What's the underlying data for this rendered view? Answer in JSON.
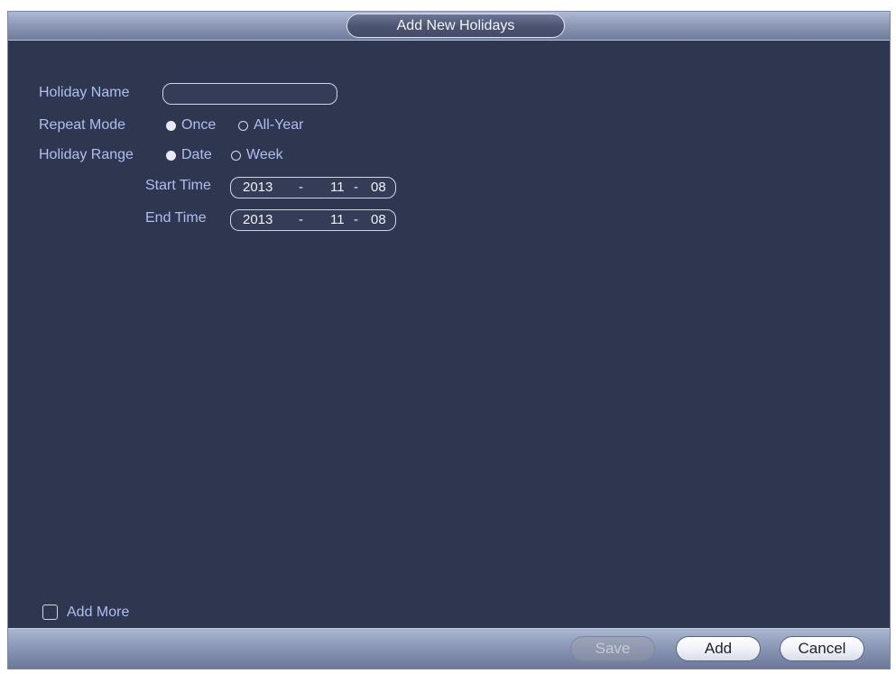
{
  "dialog": {
    "title": "Add New Holidays"
  },
  "form": {
    "holiday_name": {
      "label": "Holiday Name",
      "value": ""
    },
    "repeat_mode": {
      "label": "Repeat Mode",
      "options": [
        "Once",
        "All-Year"
      ],
      "selected": "Once"
    },
    "holiday_range": {
      "label": "Holiday Range",
      "options": [
        "Date",
        "Week"
      ],
      "selected": "Date"
    },
    "start_time": {
      "label": "Start Time",
      "year": "2013",
      "sep1": "-",
      "month": "11",
      "sep2": "-",
      "day": "08"
    },
    "end_time": {
      "label": "End Time",
      "year": "2013",
      "sep1": "-",
      "month": "11",
      "sep2": "-",
      "day": "08"
    },
    "add_more": {
      "label": "Add More",
      "checked": false
    }
  },
  "footer": {
    "save_label": "Save",
    "add_label": "Add",
    "cancel_label": "Cancel"
  },
  "colors": {
    "panel": "#2f3650",
    "label": "#aebff0",
    "accent_bar": "#8e9ab8"
  }
}
